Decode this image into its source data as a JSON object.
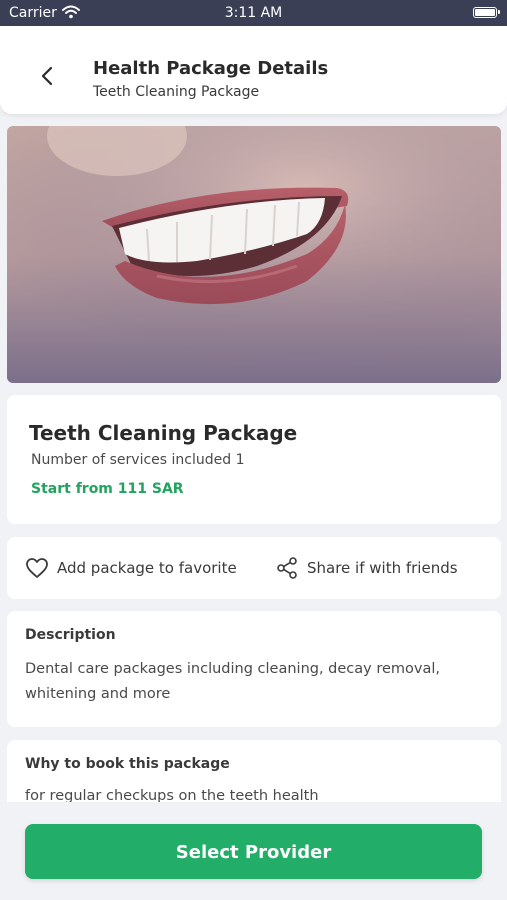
{
  "status_bar": {
    "carrier": "Carrier",
    "time": "3:11 AM"
  },
  "header": {
    "title": "Health Package Details",
    "subtitle": "Teeth Cleaning Package",
    "back_icon": "chevron-left-icon"
  },
  "package": {
    "name": "Teeth Cleaning Package",
    "services": "Number of services included 1",
    "price": "Start from 111 SAR"
  },
  "actions": {
    "favorite_label": "Add package to favorite",
    "share_label": "Share if with friends"
  },
  "description": {
    "title": "Description",
    "text": "Dental care packages including cleaning, decay removal, whitening and more"
  },
  "why": {
    "title": "Why to book this package",
    "text": "for regular checkups on the teeth health"
  },
  "footer": {
    "select_label": "Select Provider"
  },
  "colors": {
    "accent": "#22ad68",
    "price": "#22a35f",
    "status_bar": "#3a3f55",
    "background": "#f1f2f5"
  }
}
